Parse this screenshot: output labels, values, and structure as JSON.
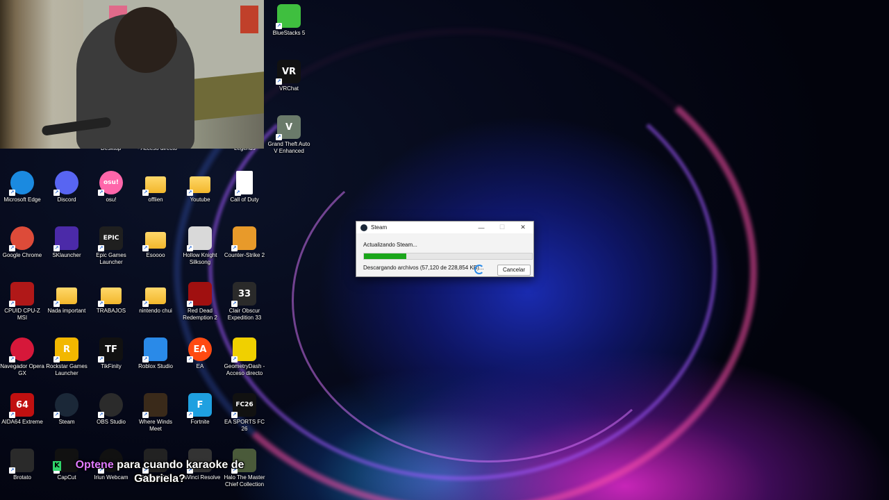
{
  "webcam": {
    "partial_labels": [
      "Desktop",
      "- Acceso directo",
      "Legends"
    ]
  },
  "desktop_icons": [
    {
      "label": "BlueStacks 5",
      "icon": "bluestacks-icon",
      "color": "#3fbf3f",
      "text": ""
    },
    {
      "label": "VRChat",
      "icon": "vrchat-icon",
      "color": "#111111",
      "text": "VR"
    },
    {
      "label": "Grand Theft Auto V Enhanced",
      "icon": "gta-icon",
      "color": "#6a7a6a",
      "text": "V"
    },
    {
      "label": "Microsoft Edge",
      "icon": "edge-icon",
      "color": "#1b8ae0",
      "text": ""
    },
    {
      "label": "Discord",
      "icon": "discord-icon",
      "color": "#5865f2",
      "text": ""
    },
    {
      "label": "osu!",
      "icon": "osu-icon",
      "color": "#ff66aa",
      "text": "osu!"
    },
    {
      "label": "offlien",
      "icon": "folder-icon",
      "color": "#f2b72c",
      "text": ""
    },
    {
      "label": "Youtube",
      "icon": "folder-icon",
      "color": "#f2b72c",
      "text": ""
    },
    {
      "label": "Call of Duty",
      "icon": "file-icon",
      "color": "#ffffff",
      "text": ""
    },
    {
      "label": "Google Chrome",
      "icon": "chrome-icon",
      "color": "#dd4b39",
      "text": ""
    },
    {
      "label": "SKlauncher",
      "icon": "sklauncher-icon",
      "color": "#4b2aa8",
      "text": ""
    },
    {
      "label": "Epic Games Launcher",
      "icon": "epic-games-icon",
      "color": "#1f1f1f",
      "text": "EPIC"
    },
    {
      "label": "Esoooo",
      "icon": "folder-icon",
      "color": "#f2b72c",
      "text": ""
    },
    {
      "label": "Hollow Knight Silksong",
      "icon": "silksong-icon",
      "color": "#d9d9d9",
      "text": ""
    },
    {
      "label": "Counter-Strike 2",
      "icon": "cs2-icon",
      "color": "#e89a2a",
      "text": ""
    },
    {
      "label": "CPUID CPU-Z MSI",
      "icon": "cpuz-icon",
      "color": "#b01818",
      "text": ""
    },
    {
      "label": "Nada important",
      "icon": "folder-icon",
      "color": "#f2b72c",
      "text": ""
    },
    {
      "label": "TRABAJOS",
      "icon": "folder-icon",
      "color": "#f2b72c",
      "text": ""
    },
    {
      "label": "nintendo chui",
      "icon": "folder-icon",
      "color": "#f2b72c",
      "text": ""
    },
    {
      "label": "Red Dead Redemption 2",
      "icon": "rdr2-icon",
      "color": "#a01010",
      "text": ""
    },
    {
      "label": "Clair Obscur Expedition 33",
      "icon": "clair-obscur-icon",
      "color": "#2a2a2a",
      "text": "33"
    },
    {
      "label": "Navegador Opera GX",
      "icon": "opera-gx-icon",
      "color": "#d6183a",
      "text": ""
    },
    {
      "label": "Rockstar Games Launcher",
      "icon": "rockstar-icon",
      "color": "#f2b700",
      "text": "R"
    },
    {
      "label": "TikFinity",
      "icon": "tikfinity-icon",
      "color": "#111111",
      "text": "TF"
    },
    {
      "label": "Roblox Studio",
      "icon": "roblox-studio-icon",
      "color": "#2a8ae8",
      "text": ""
    },
    {
      "label": "EA",
      "icon": "ea-icon",
      "color": "#ff4a12",
      "text": "EA"
    },
    {
      "label": "GeometryDash - Acceso directo",
      "icon": "geometry-dash-icon",
      "color": "#f0d000",
      "text": ""
    },
    {
      "label": "AIDA64 Extreme",
      "icon": "aida64-icon",
      "color": "#c01010",
      "text": "64"
    },
    {
      "label": "Steam",
      "icon": "steam-icon",
      "color": "#1b2838",
      "text": ""
    },
    {
      "label": "OBS Studio",
      "icon": "obs-icon",
      "color": "#2b2b2b",
      "text": ""
    },
    {
      "label": "Where Winds Meet",
      "icon": "where-winds-meet-icon",
      "color": "#3a2a1a",
      "text": ""
    },
    {
      "label": "Fortnite",
      "icon": "fortnite-icon",
      "color": "#1fa0e0",
      "text": "F"
    },
    {
      "label": "EA SPORTS FC 26",
      "icon": "fc26-icon",
      "color": "#111111",
      "text": "FC26"
    },
    {
      "label": "Brotato",
      "icon": "brotato-icon",
      "color": "#2a2a2a",
      "text": ""
    },
    {
      "label": "CapCut",
      "icon": "capcut-icon",
      "color": "#111111",
      "text": ""
    },
    {
      "label": "Iriun Webcam",
      "icon": "iriun-icon",
      "color": "#111111",
      "text": ""
    },
    {
      "label": "UrbanVPN",
      "icon": "urbanvpn-icon",
      "color": "#222222",
      "text": ""
    },
    {
      "label": "DaVinci Resolve",
      "icon": "davinci-icon",
      "color": "#333333",
      "text": ""
    },
    {
      "label": "Halo The Master Chief Collection",
      "icon": "halo-icon",
      "color": "#4a5a3a",
      "text": ""
    }
  ],
  "dialog": {
    "title": "Steam",
    "status": "Actualizando Steam...",
    "progress_fraction": 0.25,
    "detail": "Descargando archivos (57,120 de 228,854 KB)...",
    "cancel_label": "Cancelar",
    "minimize": "—",
    "maximize": "☐",
    "close": "✕",
    "progress_color": "#1aa61a"
  },
  "subtitle": {
    "part1": "Optene",
    "part2": " para cuando karaoke de",
    "line2": "Gabriela?"
  }
}
